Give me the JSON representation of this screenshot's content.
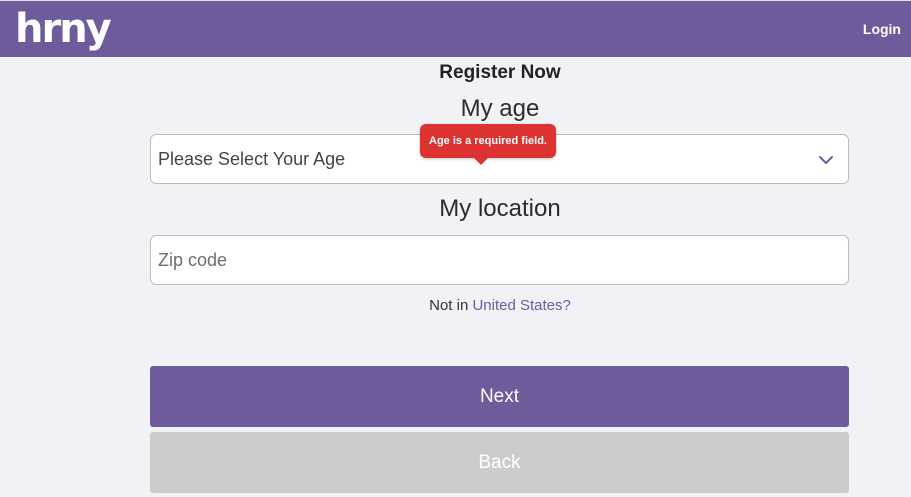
{
  "header": {
    "logo_text": "hrny",
    "login_label": "Login"
  },
  "form": {
    "title": "Register Now",
    "age_label": "My age",
    "age_select_value": "Please Select Your Age",
    "age_error": "Age is a required field.",
    "location_label": "My location",
    "zip_placeholder": "Zip code",
    "not_in_prefix": "Not in",
    "country_link": "United States?",
    "next_label": "Next",
    "back_label": "Back"
  },
  "colors": {
    "brand": "#6f5a9c",
    "error": "#dc3232",
    "disabled": "#cccccc",
    "background": "#f1f2f6"
  },
  "icons": {
    "select_arrow": "chevron-down-icon"
  }
}
